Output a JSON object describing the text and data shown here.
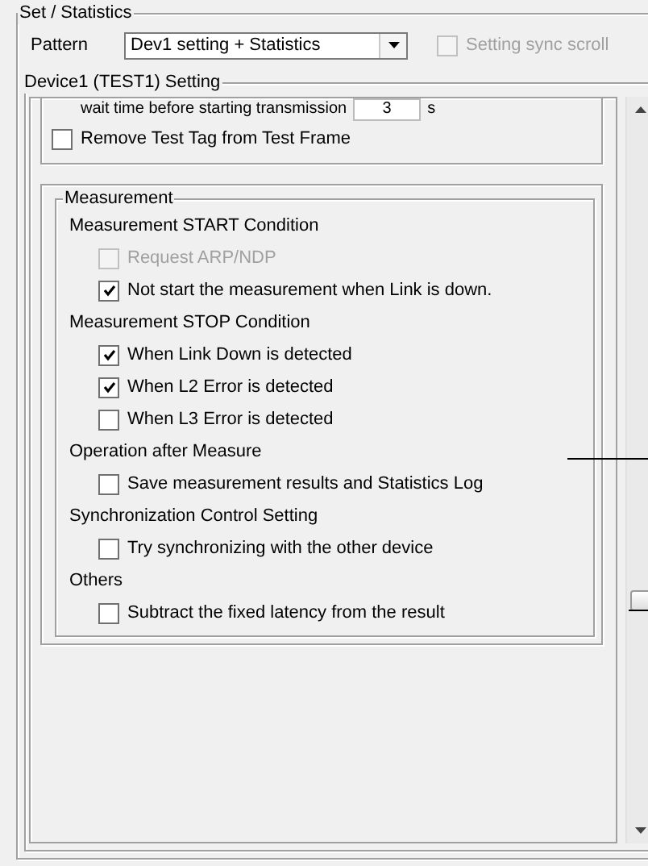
{
  "group_title": "Set / Statistics",
  "pattern": {
    "label": "Pattern",
    "value": "Dev1 setting + Statistics"
  },
  "sync_scroll": {
    "label": "Setting sync scroll",
    "checked": false,
    "disabled": true
  },
  "device_group": {
    "title": "Device1 (TEST1) Setting"
  },
  "transmission": {
    "wait_label": "wait time before starting transmission",
    "wait_value": "3",
    "wait_unit": "s",
    "remove_tag": {
      "label": "Remove Test Tag from Test Frame",
      "checked": false,
      "disabled": false
    }
  },
  "measurement": {
    "title": "Measurement",
    "sections": [
      {
        "title": "Measurement START Condition",
        "options": [
          {
            "label": "Request ARP/NDP",
            "checked": false,
            "disabled": true
          },
          {
            "label": "Not start the measurement when Link is down.",
            "checked": true,
            "disabled": false
          }
        ]
      },
      {
        "title": "Measurement STOP Condition",
        "options": [
          {
            "label": "When Link Down is detected",
            "checked": true,
            "disabled": false
          },
          {
            "label": "When L2 Error is detected",
            "checked": true,
            "disabled": false
          },
          {
            "label": "When L3 Error is detected",
            "checked": false,
            "disabled": false
          }
        ]
      },
      {
        "title": "Operation after Measure",
        "options": [
          {
            "label": "Save measurement results and Statistics Log",
            "checked": false,
            "disabled": false
          }
        ]
      },
      {
        "title": "Synchronization Control Setting",
        "options": [
          {
            "label": "Try synchronizing with the other device",
            "checked": false,
            "disabled": false
          }
        ]
      },
      {
        "title": "Others",
        "options": [
          {
            "label": "Subtract the fixed latency from the result",
            "checked": false,
            "disabled": false
          }
        ]
      }
    ]
  }
}
